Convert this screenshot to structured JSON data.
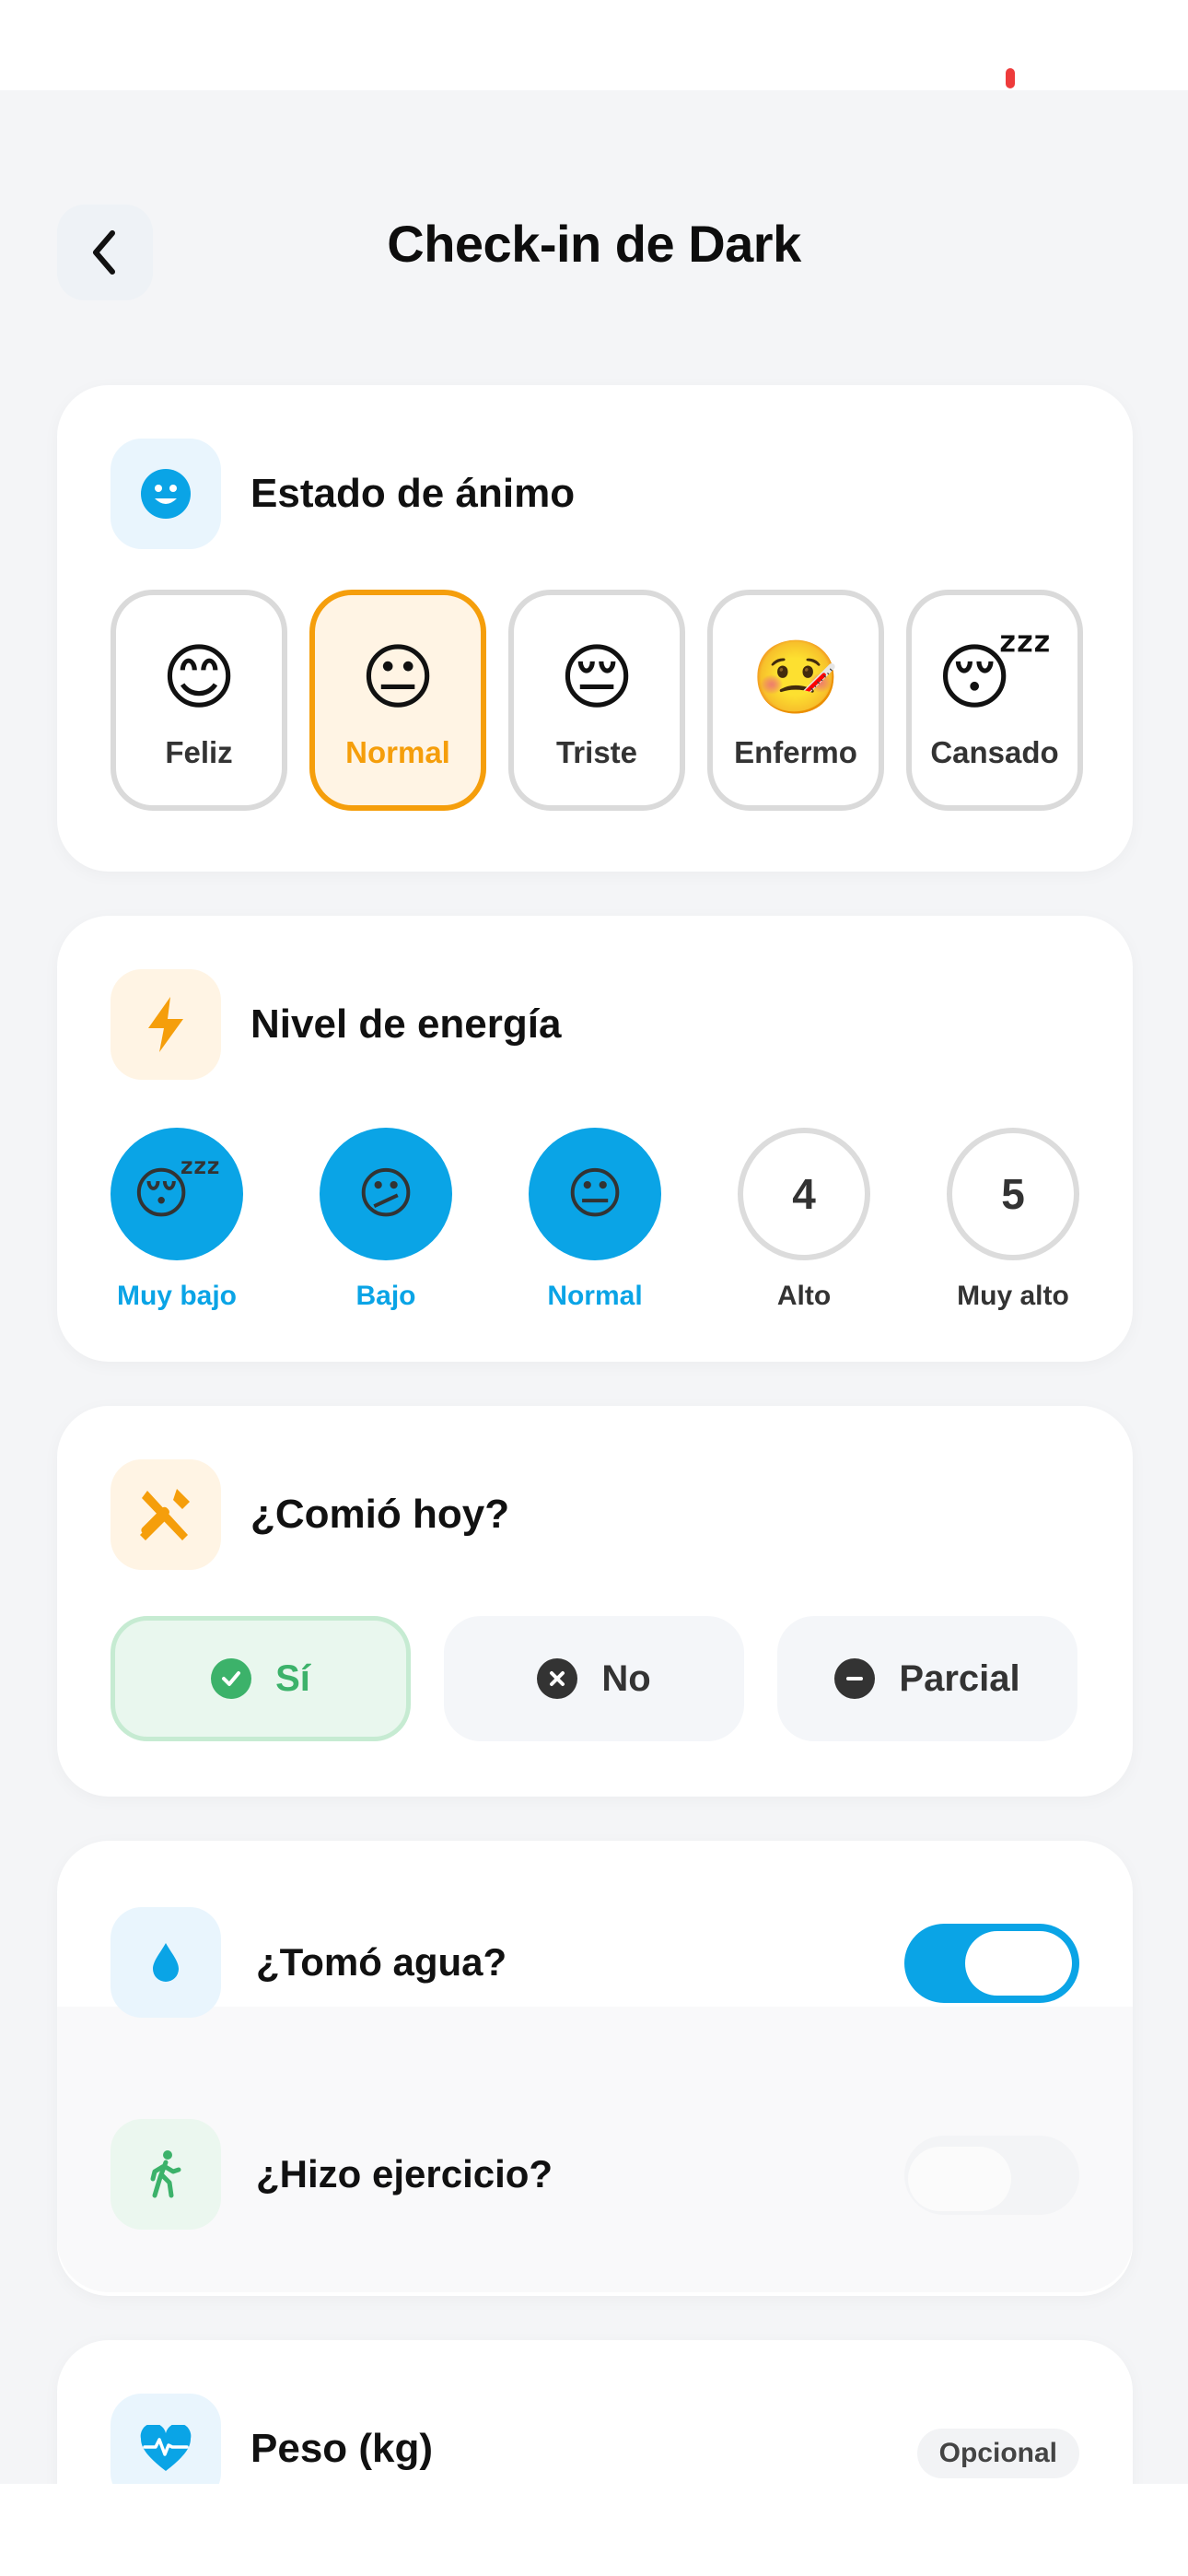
{
  "header": {
    "title": "Check-in de Dark",
    "back_icon": "chevron-left-icon"
  },
  "mood": {
    "title": "Estado de ánimo",
    "icon": "smile-face-icon",
    "options": [
      {
        "emoji": "😊",
        "label": "Feliz"
      },
      {
        "emoji": "😐",
        "label": "Normal"
      },
      {
        "emoji": "😔",
        "label": "Triste"
      },
      {
        "emoji": "🤒",
        "label": "Enfermo"
      },
      {
        "emoji": "😴",
        "label": "Cansado"
      }
    ],
    "selected": "Normal"
  },
  "energy": {
    "title": "Nivel de energía",
    "icon": "lightning-icon",
    "levels": [
      {
        "display": "😴",
        "label": "Muy bajo"
      },
      {
        "display": "😕",
        "label": "Bajo"
      },
      {
        "display": "😐",
        "label": "Normal"
      },
      {
        "display": "4",
        "label": "Alto"
      },
      {
        "display": "5",
        "label": "Muy alto"
      }
    ],
    "selected_level": 3
  },
  "ate": {
    "title": "¿Comió hoy?",
    "icon": "fork-knife-icon",
    "options": [
      {
        "label": "Sí",
        "icon": "check-circle-icon"
      },
      {
        "label": "No",
        "icon": "x-circle-icon"
      },
      {
        "label": "Parcial",
        "icon": "minus-circle-icon"
      }
    ],
    "selected": "Sí"
  },
  "water": {
    "label": "¿Tomó agua?",
    "icon": "water-drop-icon",
    "on": true
  },
  "exercise": {
    "label": "¿Hizo ejercicio?",
    "icon": "walking-person-icon",
    "on": false
  },
  "weight": {
    "title": "Peso (kg)",
    "icon": "heart-pulse-icon",
    "badge": "Opcional"
  },
  "colors": {
    "accent_blue": "#0aa4e6",
    "accent_orange": "#f59e0b",
    "success_green": "#3cb26a"
  }
}
